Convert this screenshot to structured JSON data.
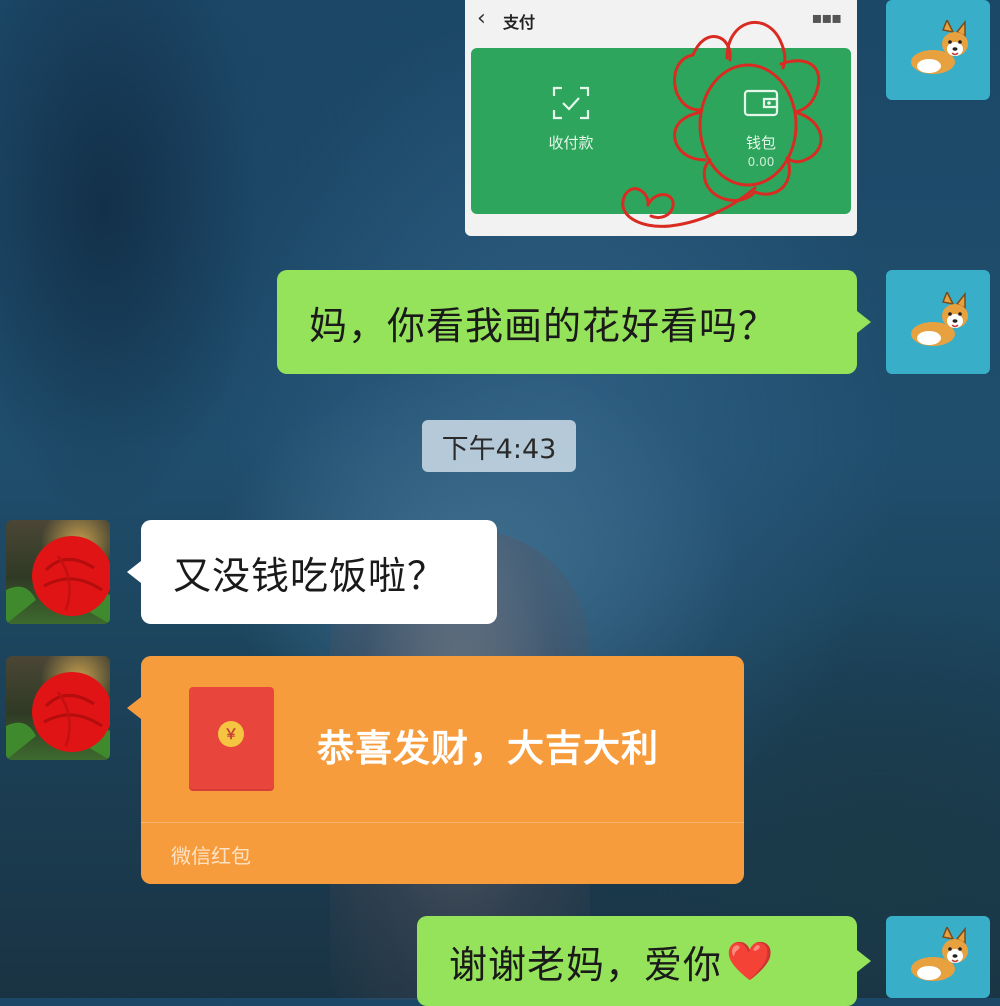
{
  "screenshot_card": {
    "back_icon": "chevron-left-icon",
    "title": "支付",
    "more_icon": "more-dots-icon",
    "items": [
      {
        "icon": "scan-check-icon",
        "label": "收付款",
        "sub": ""
      },
      {
        "icon": "wallet-icon",
        "label": "钱包",
        "sub": "0.00"
      }
    ],
    "doodle_color": "#d92b22"
  },
  "messages": [
    {
      "side": "right",
      "text": "妈，你看我画的花好看吗？"
    },
    {
      "side": "left",
      "text": "又没钱吃饭啦？"
    },
    {
      "side": "right",
      "text": "谢谢老妈，爱你",
      "emoji": "❤️"
    }
  ],
  "timestamp": "下午4:43",
  "red_packet": {
    "title": "恭喜发财，大吉大利",
    "footer": "微信红包",
    "coin_glyph": "￥"
  },
  "colors": {
    "green_bubble": "#95e35a",
    "white_bubble": "#ffffff",
    "red_packet_orange": "#f79c3c",
    "dog_avatar_bg": "#38aec9",
    "wechat_pay_green": "#2da55c"
  },
  "avatars": {
    "self": "corgi-avatar",
    "mom": "red-rose-avatar"
  }
}
